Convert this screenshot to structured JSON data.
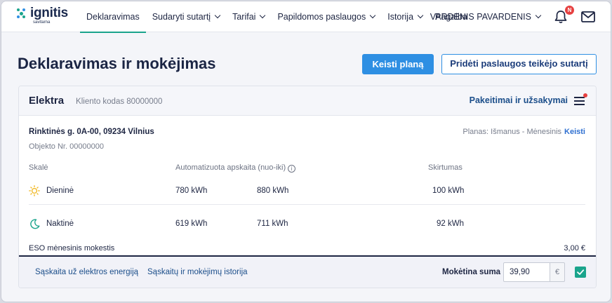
{
  "brand": {
    "name": "ignitis",
    "sub": "savitarna",
    "colors": {
      "accent": "#1aa48c",
      "primary": "#2e8fe3",
      "navy": "#1d2542",
      "alert": "#e64141"
    }
  },
  "nav": {
    "items": [
      {
        "label": "Deklaravimas",
        "active": true
      },
      {
        "label": "Sudaryti sutartį",
        "dropdown": true
      },
      {
        "label": "Tarifai",
        "dropdown": true
      },
      {
        "label": "Papildomos paslaugos",
        "dropdown": true
      },
      {
        "label": "Istorija",
        "dropdown": true
      },
      {
        "label": "Pagalba"
      }
    ],
    "user": "VARDENIS PAVARDENIS",
    "notification_badge": "N",
    "icons": [
      "bell-icon",
      "mail-icon",
      "chevron-down-icon"
    ]
  },
  "header": {
    "title": "Deklaravimas ir mokėjimas",
    "primary_button": "Keisti planą",
    "secondary_button": "Pridėti paslaugos teikėjo sutartį"
  },
  "card": {
    "title": "Elektra",
    "client_code": "Kliento kodas 80000000",
    "changes_link": "Pakeitimai ir užsakymai",
    "address": "Rinktinės g. 0A-00, 09234 Vilnius",
    "object_nr": "Objekto Nr. 00000000",
    "plan_label": "Planas: Išmanus - Mėnesinis",
    "plan_change": "Keisti",
    "columns": {
      "scale": "Skalė",
      "auto": "Automatizuota apskaita (nuo-iki)",
      "diff": "Skirtumas"
    },
    "rows": [
      {
        "name": "Dieninė",
        "icon": "sun-icon",
        "from": "780 kWh",
        "to": "880 kWh",
        "diff": "100 kWh"
      },
      {
        "name": "Naktinė",
        "icon": "moon-icon",
        "from": "619 kWh",
        "to": "711 kWh",
        "diff": "92 kWh"
      }
    ],
    "eso_label": "ESO mėnesinis mokestis",
    "eso_value": "3,00 €"
  },
  "footer": {
    "link_invoice": "Sąskaita už elektros energiją",
    "link_history": "Sąskaitų ir mokėjimų istorija",
    "pay_label": "Mokėtina suma",
    "pay_value": "39,90",
    "currency": "€",
    "checked": true
  }
}
